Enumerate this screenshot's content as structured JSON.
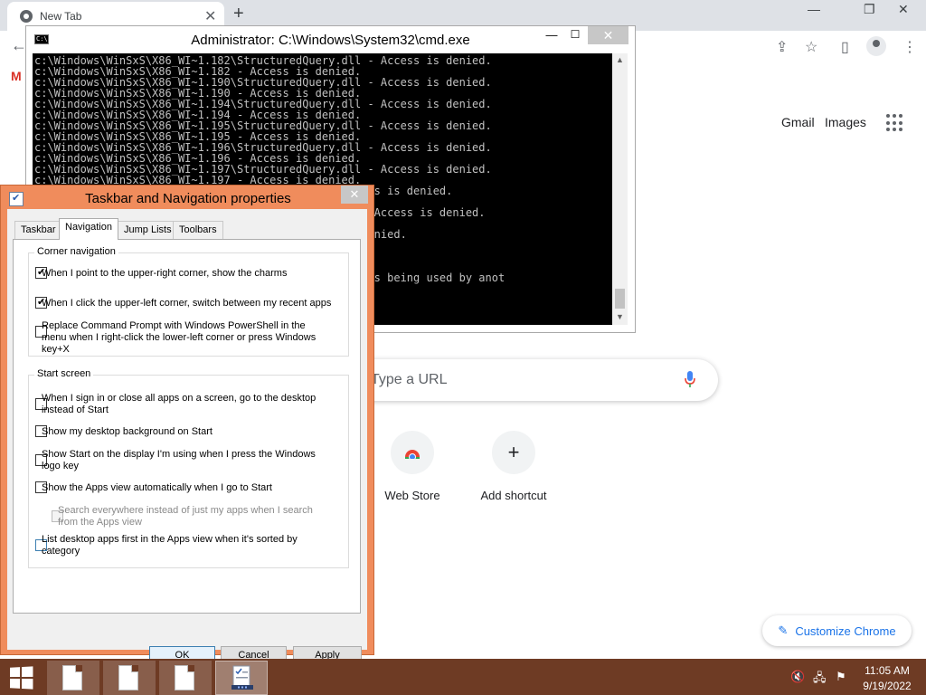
{
  "browser": {
    "tab_title": "New Tab",
    "tab_close": "✕",
    "new_tab": "+",
    "window_minimize": "—",
    "window_restore": "❐",
    "window_close": "✕",
    "back_icon": "←",
    "gmail_favicon": "M",
    "share_icon": "⇪",
    "star_icon": "☆",
    "sidepanel_icon": "▯",
    "menu_icon": "⋮",
    "gmail_link": "Gmail",
    "images_link": "Images",
    "search_placeholder": "Type a URL",
    "shortcuts": [
      {
        "label": "Web Store"
      },
      {
        "label": "Add shortcut",
        "icon": "+"
      }
    ],
    "customize_label": "Customize Chrome",
    "customize_icon": "✎"
  },
  "cmd": {
    "title": "Administrator: C:\\Windows\\System32\\cmd.exe",
    "icon_text": "C:\\.",
    "minimize": "—",
    "maximize": "☐",
    "close": "✕",
    "lines": [
      "c:\\Windows\\WinSxS\\X86_WI~1.182\\StructuredQuery.dll - Access is denied.",
      "c:\\Windows\\WinSxS\\X86_WI~1.182 - Access is denied.",
      "c:\\Windows\\WinSxS\\X86_WI~1.190\\StructuredQuery.dll - Access is denied.",
      "c:\\Windows\\WinSxS\\X86_WI~1.190 - Access is denied.",
      "c:\\Windows\\WinSxS\\X86_WI~1.194\\StructuredQuery.dll - Access is denied.",
      "c:\\Windows\\WinSxS\\X86_WI~1.194 - Access is denied.",
      "c:\\Windows\\WinSxS\\X86_WI~1.195\\StructuredQuery.dll - Access is denied.",
      "c:\\Windows\\WinSxS\\X86_WI~1.195 - Access is denied.",
      "c:\\Windows\\WinSxS\\X86_WI~1.196\\StructuredQuery.dll - Access is denied.",
      "c:\\Windows\\WinSxS\\X86_WI~1.196 - Access is denied.",
      "c:\\Windows\\WinSxS\\X86_WI~1.197\\StructuredQuery.dll - Access is denied.",
      "c:\\Windows\\WinSxS\\X86_WI~1.197 - Access is denied.",
      "                                        .exe - Access is denied.",
      "                                        ied.",
      "                                        Proxy.dll - Access is denied.",
      "                                        ied.",
      "                                        Access is denied.",
      "                                        ied.",
      "",
      "",
      "                                        because it is being used by anot",
      "",
      "",
      ""
    ]
  },
  "dialog": {
    "title": "Taskbar and Navigation properties",
    "close": "✕",
    "tabs": [
      "Taskbar",
      "Navigation",
      "Jump Lists",
      "Toolbars"
    ],
    "corner_group": "Corner navigation",
    "corner_options": [
      {
        "label": "When I point to the upper-right corner, show the charms",
        "checked": true
      },
      {
        "label": "When I click the upper-left corner, switch between my recent apps",
        "checked": true
      },
      {
        "label": "Replace Command Prompt with Windows PowerShell in the menu when I right-click the lower-left corner or press Windows key+X",
        "checked": false
      }
    ],
    "start_group": "Start screen",
    "start_options": [
      {
        "label": "When I sign in or close all apps on a screen, go to the desktop instead of Start",
        "checked": false
      },
      {
        "label": "Show my desktop background on Start",
        "checked": false
      },
      {
        "label": "Show Start on the display I'm using when I press the Windows logo key",
        "checked": false
      },
      {
        "label": "Show the Apps view automatically when I go to Start",
        "checked": false
      },
      {
        "label": "Search everywhere instead of just my apps when I search from the Apps view",
        "checked": false,
        "disabled": true
      },
      {
        "label": "List desktop apps first in the Apps view when it's sorted by category",
        "checked": false
      }
    ],
    "buttons": {
      "ok": "OK",
      "cancel": "Cancel",
      "apply": "Apply"
    }
  },
  "taskbar": {
    "time": "11:05 AM",
    "date": "9/19/2022",
    "tray": {
      "volume": "🔇",
      "network": "🖧",
      "flag": "⚑"
    }
  }
}
